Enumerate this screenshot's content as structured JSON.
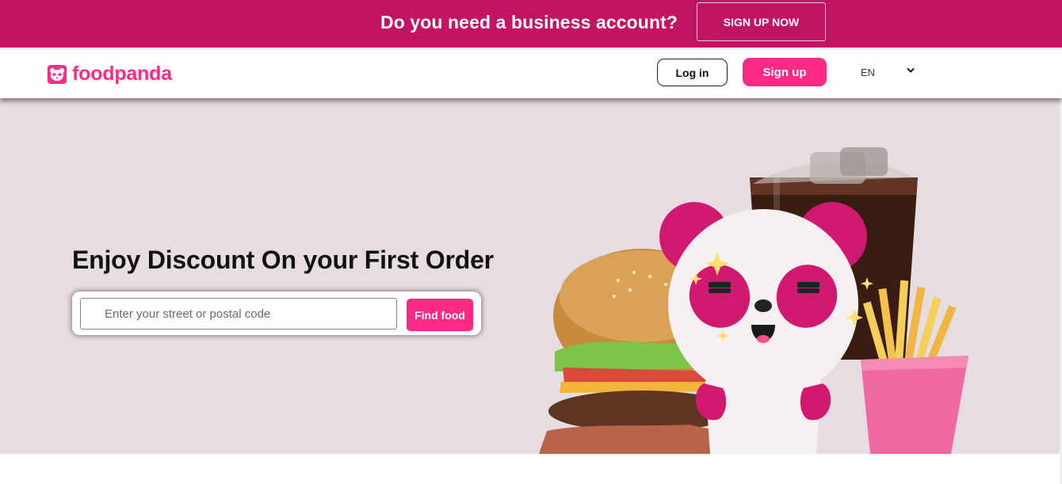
{
  "promo": {
    "text": "Do you need a business account?",
    "button_label": "SIGN UP NOW",
    "background": "#c21462"
  },
  "header": {
    "brand": "foodpanda",
    "brand_color": "#ff2b85",
    "logo_icon": "panda-face-icon",
    "login_label": "Log in",
    "signup_label": "Sign up",
    "language": "EN",
    "language_icon": "chevron-down-icon"
  },
  "hero": {
    "title": "Enjoy Discount On your First Order",
    "search_placeholder": "Enter your street or postal code",
    "find_button": "Find food",
    "background": "#e6dde2",
    "illustration": "panda-mascot-with-burger-fries-soda"
  }
}
